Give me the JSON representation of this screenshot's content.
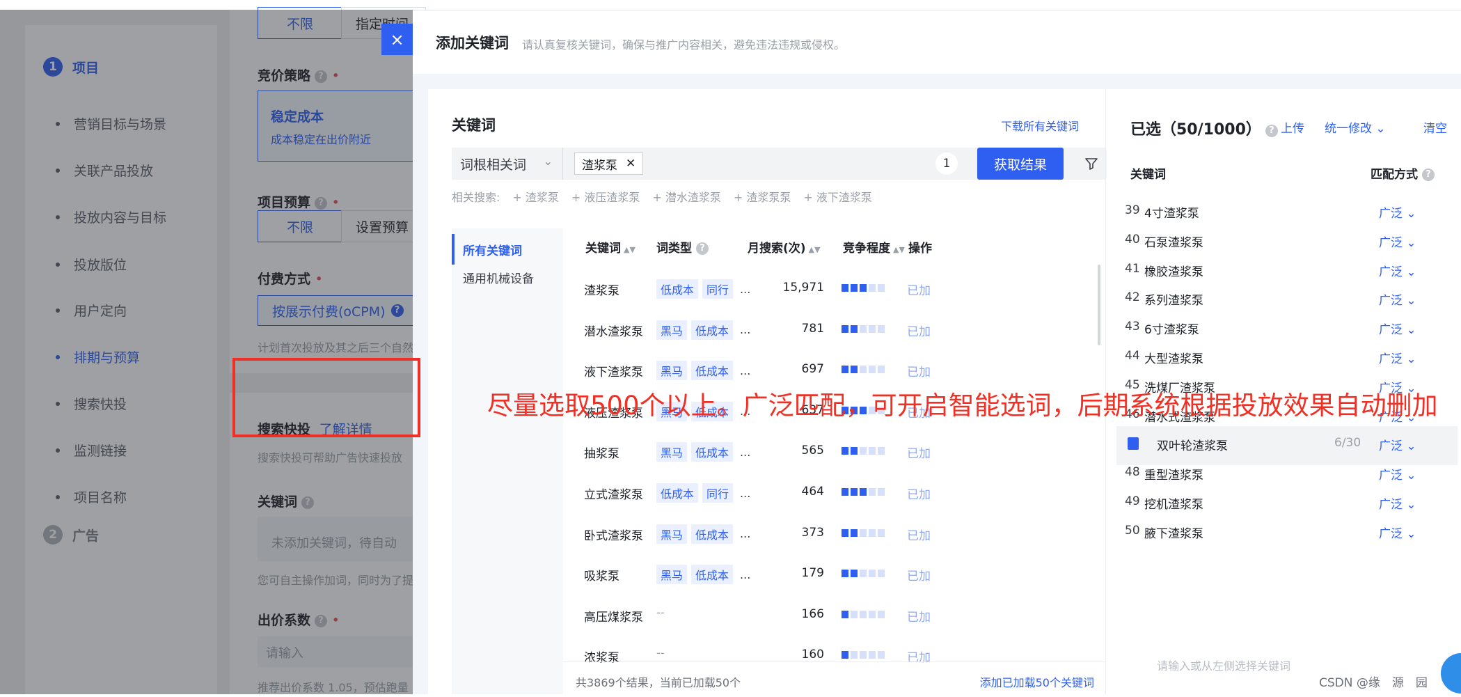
{
  "steps": {
    "project": {
      "num": "1",
      "label": "项目"
    },
    "items": [
      "营销目标与场景",
      "关联产品投放",
      "投放内容与目标",
      "投放版位",
      "用户定向",
      "排期与预算",
      "搜索快投",
      "监测链接",
      "项目名称"
    ],
    "active_item": "排期与预算",
    "ad": {
      "num": "2",
      "label": "广告"
    }
  },
  "form": {
    "top_unlimited": "不限",
    "top_specified": "指定时间",
    "bid_strategy_label": "竞价策略",
    "stable_cost_title": "稳定成本",
    "stable_cost_desc": "成本稳定在出价附近",
    "budget_label": "项目预算",
    "budget_unlimited": "不限",
    "budget_set": "设置预算",
    "payment_label": "付费方式",
    "payment_value": "按展示付费(oCPM)",
    "payment_hint": "计划首次投放及其之后三个自然日",
    "search_fast_title": "搜索快投",
    "search_fast_link": "了解详情",
    "search_fast_hint": "搜索快投可帮助广告快速投放",
    "keyword_label": "关键词",
    "keyword_placeholder": "未添加关键词，待自动",
    "keyword_hint": "您可自主操作加词，同时为了提",
    "bid_coef_label": "出价系数",
    "bid_coef_placeholder": "请输入",
    "bid_coef_hint": "推荐出价系数 1.05，预估跑量"
  },
  "drawer": {
    "close": "×",
    "title": "添加关键词",
    "desc": "请认真复核关键词，确保与推广内容相关，避免违法违规或侵权。",
    "left": {
      "title": "关键词",
      "download": "下载所有关键词",
      "search_type": "词根相关词",
      "tag": "渣浆泵",
      "tag_count": "1",
      "fetch": "获取结果",
      "related_label": "相关搜索:",
      "related": [
        "+ 渣浆泵",
        "+ 液压渣浆泵",
        "+ 潜水渣浆泵",
        "+ 渣浆泵泵",
        "+ 液下渣浆泵"
      ],
      "categories": [
        "所有关键词",
        "通用机械设备"
      ],
      "columns": {
        "keyword": "关键词",
        "type": "词类型",
        "volume": "月搜索(次)",
        "competition": "竞争程度",
        "op": "操作"
      },
      "rows": [
        {
          "name": "渣浆泵",
          "tags": [
            "低成本",
            "同行"
          ],
          "volume": "15,971",
          "comp": 3,
          "op": "已加"
        },
        {
          "name": "潜水渣浆泵",
          "tags": [
            "黑马",
            "低成本"
          ],
          "volume": "781",
          "comp": 2,
          "op": "已加"
        },
        {
          "name": "液下渣浆泵",
          "tags": [
            "黑马",
            "低成本"
          ],
          "volume": "697",
          "comp": 2,
          "op": "已加"
        },
        {
          "name": "液压渣浆泵",
          "tags": [
            "黑马",
            "低成本"
          ],
          "volume": "637",
          "comp": 3,
          "op": "已加"
        },
        {
          "name": "抽浆泵",
          "tags": [
            "黑马",
            "低成本"
          ],
          "volume": "565",
          "comp": 2,
          "op": "已加"
        },
        {
          "name": "立式渣浆泵",
          "tags": [
            "低成本",
            "同行"
          ],
          "volume": "464",
          "comp": 3,
          "op": "已加"
        },
        {
          "name": "卧式渣浆泵",
          "tags": [
            "黑马",
            "低成本"
          ],
          "volume": "373",
          "comp": 2,
          "op": "已加"
        },
        {
          "name": "吸浆泵",
          "tags": [
            "黑马",
            "低成本"
          ],
          "volume": "179",
          "comp": 2,
          "op": "已加"
        },
        {
          "name": "高压煤浆泵",
          "tags": [],
          "volume": "166",
          "comp": 1,
          "op": "已加"
        },
        {
          "name": "浓浆泵",
          "tags": [],
          "volume": "160",
          "comp": 1,
          "op": "已加"
        }
      ],
      "more": "...",
      "dash": "--",
      "footer_count": "共3869个结果，当前已加载50个",
      "footer_add": "添加已加载50个关键词"
    },
    "right": {
      "title": "已选（50/1000）",
      "upload": "上传",
      "bulk_edit": "统一修改",
      "clear": "清空",
      "col_keyword": "关键词",
      "col_match": "匹配方式",
      "rows": [
        {
          "idx": "39",
          "name": "4寸渣浆泵",
          "match": "广泛"
        },
        {
          "idx": "40",
          "name": "石泵渣浆泵",
          "match": "广泛"
        },
        {
          "idx": "41",
          "name": "橡胶渣浆泵",
          "match": "广泛"
        },
        {
          "idx": "42",
          "name": "系列渣浆泵",
          "match": "广泛"
        },
        {
          "idx": "43",
          "name": "6寸渣浆泵",
          "match": "广泛"
        },
        {
          "idx": "44",
          "name": "大型渣浆泵",
          "match": "广泛"
        },
        {
          "idx": "45",
          "name": "洗煤厂渣浆泵",
          "match": "广泛"
        },
        {
          "idx": "46",
          "name": "潜水式渣浆泵",
          "match": "广泛"
        },
        {
          "idx": "",
          "name": "双叶轮渣浆泵",
          "match": "广泛",
          "count": "6/30",
          "highlight": true
        },
        {
          "idx": "48",
          "name": "重型渣浆泵",
          "match": "广泛"
        },
        {
          "idx": "49",
          "name": "挖机渣浆泵",
          "match": "广泛"
        },
        {
          "idx": "50",
          "name": "腋下渣浆泵",
          "match": "广泛"
        }
      ],
      "placeholder": "请输入或从左侧选择关键词"
    }
  },
  "annotation": "尽量选取500个以上。广泛匹配，可开启智能选词，后期系统根据投放效果自动删加",
  "watermark": "CSDN @缘　源　园",
  "colors": {
    "accent": "#2f5ff0",
    "annotation": "#f03024",
    "overlay": "rgba(40,44,52,0.45)"
  }
}
